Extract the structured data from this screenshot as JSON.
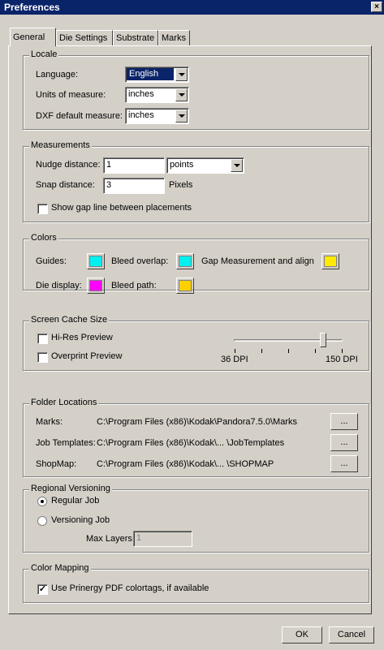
{
  "window": {
    "title": "Preferences",
    "close_glyph": "×"
  },
  "tabs": [
    {
      "label": "General",
      "active": true
    },
    {
      "label": "Die Settings",
      "active": false
    },
    {
      "label": "Substrate",
      "active": false
    },
    {
      "label": "Marks",
      "active": false
    }
  ],
  "locale": {
    "title": "Locale",
    "language_label": "Language:",
    "language_value": "English",
    "units_label": "Units of measure:",
    "units_value": "inches",
    "dxf_label": "DXF default measure:",
    "dxf_value": "inches"
  },
  "measurements": {
    "title": "Measurements",
    "nudge_label": "Nudge distance:",
    "nudge_value": "1",
    "nudge_unit": "points",
    "snap_label": "Snap distance:",
    "snap_value": "3",
    "snap_unit": "Pixels",
    "gap_label": "Show gap line between placements",
    "gap_checked": false
  },
  "colors": {
    "title": "Colors",
    "guides_label": "Guides:",
    "guides_color": "#00f0f0",
    "bleed_overlap_label": "Bleed overlap:",
    "bleed_overlap_color": "#00f0f0",
    "gap_label": "Gap Measurement and align",
    "gap_color": "#ffea00",
    "die_display_label": "Die display:",
    "die_display_color": "#ff00ff",
    "bleed_path_label": "Bleed path:",
    "bleed_path_color": "#ffd000"
  },
  "cache": {
    "title": "Screen Cache Size",
    "hires_label": "Hi-Res Preview",
    "hires_checked": false,
    "overprint_label": "Overprint Preview",
    "overprint_checked": false,
    "slider_min_label": "36 DPI",
    "slider_max_label": "150 DPI",
    "slider_level": 0.82
  },
  "folders": {
    "title": "Folder Locations",
    "rows": [
      {
        "label": "Marks:",
        "path": "C:\\Program Files (x86)\\Kodak\\Pandora7.5.0\\Marks",
        "button": "..."
      },
      {
        "label": "Job Templates:",
        "path": "C:\\Program Files (x86)\\Kodak\\... \\JobTemplates",
        "button": "..."
      },
      {
        "label": "ShopMap:",
        "path": "C:\\Program Files (x86)\\Kodak\\... \\SHOPMAP",
        "button": "..."
      }
    ]
  },
  "versioning": {
    "title": "Regional Versioning",
    "regular_label": "Regular Job",
    "regular_selected": true,
    "versioning_label": "Versioning Job",
    "versioning_selected": false,
    "max_layers_label": "Max Layers:",
    "max_layers_value": "1"
  },
  "color_mapping": {
    "title": "Color Mapping",
    "use_label": "Use Prinergy PDF colortags, if available",
    "use_checked": true,
    "check_glyph": "✓"
  },
  "footer": {
    "ok_label": "OK",
    "cancel_label": "Cancel"
  }
}
